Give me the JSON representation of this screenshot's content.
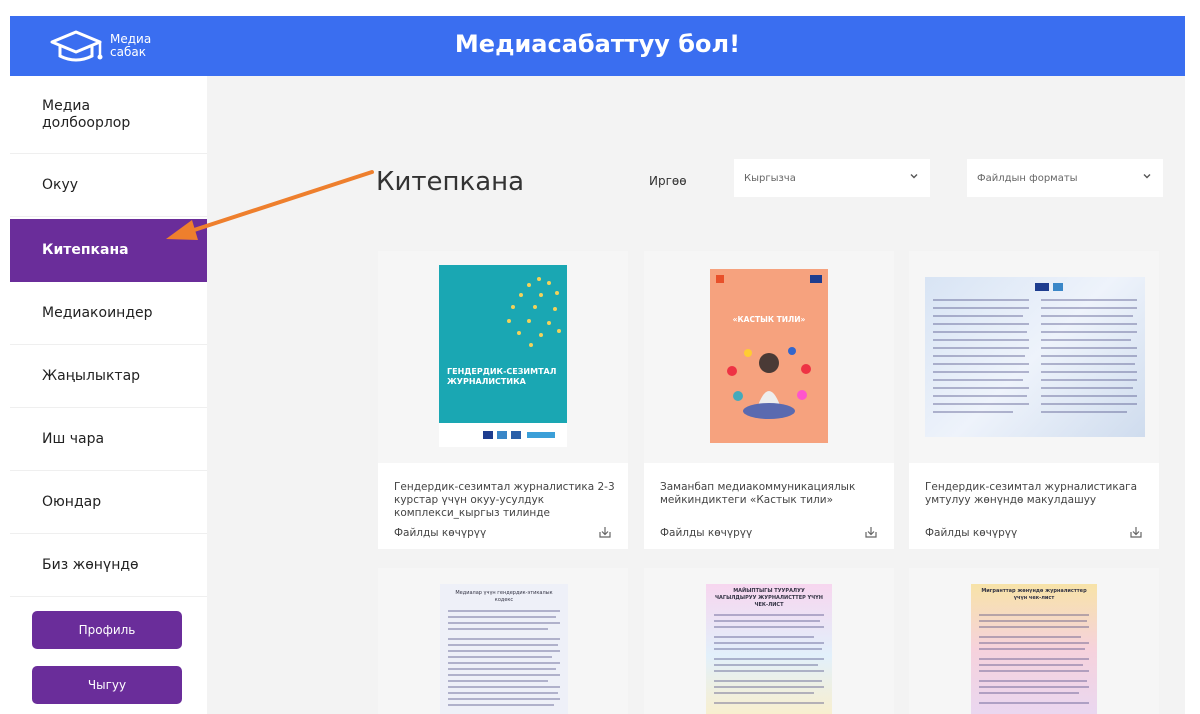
{
  "header": {
    "logo_line1": "Медиа",
    "logo_line2": "сабак",
    "title": "Медиасабаттуу бол!"
  },
  "sidebar": {
    "items": [
      {
        "label": "Медиа\nдолбоорлор"
      },
      {
        "label": "Окуу"
      },
      {
        "label": "Китепкана",
        "active": true
      },
      {
        "label": "Медиакоиндер"
      },
      {
        "label": "Жаңылыктар"
      },
      {
        "label": "Иш чара"
      },
      {
        "label": "Оюндар"
      },
      {
        "label": "Биз жөнүндө"
      }
    ],
    "profile_button": "Профиль",
    "logout_button": "Чыгуу"
  },
  "main": {
    "page_title": "Китепкана",
    "language_label": "Иргөө",
    "language_select_value": "Кыргызча",
    "format_select_value": "Файлдын форматы",
    "cards": [
      {
        "title": "Гендердик-сезимтал журналистика 2-3 курстар үчүн окуу-усулдук комплекси_кыргыз тилинде",
        "download": "Файлды көчүрүү",
        "cover_text": "ГЕНДЕРДИК-СЕЗИМТАЛ ЖУРНАЛИСТИКА"
      },
      {
        "title": "Заманбап медиакоммуникациялык мейкиндиктеги «Кастык тили»",
        "download": "Файлды көчүрүү",
        "cover_text": "«КАСТЫК ТИЛИ»"
      },
      {
        "title": "Гендердик-сезимтал журналистикага умтулуу жөнүндө макулдашуу",
        "download": "Файлды көчүрүү"
      },
      {
        "cover_text": "Медиалар үчүн гендердик-этикалык кодекс"
      },
      {
        "cover_text": "МАЙЫПТЫГЫ ТУУРАЛУУ ЧАГЫЛДЫРУУ ЖУРНАЛИСТТЕР ҮЧҮН ЧЕК-ЛИСТ"
      },
      {
        "cover_text": "Мигранттар жөнүндө журналисттер үчүн чек-лист"
      }
    ]
  },
  "colors": {
    "header_blue": "#3a6ef0",
    "active_purple": "#6a2d9a",
    "arrow_orange": "#ee7f2d"
  }
}
